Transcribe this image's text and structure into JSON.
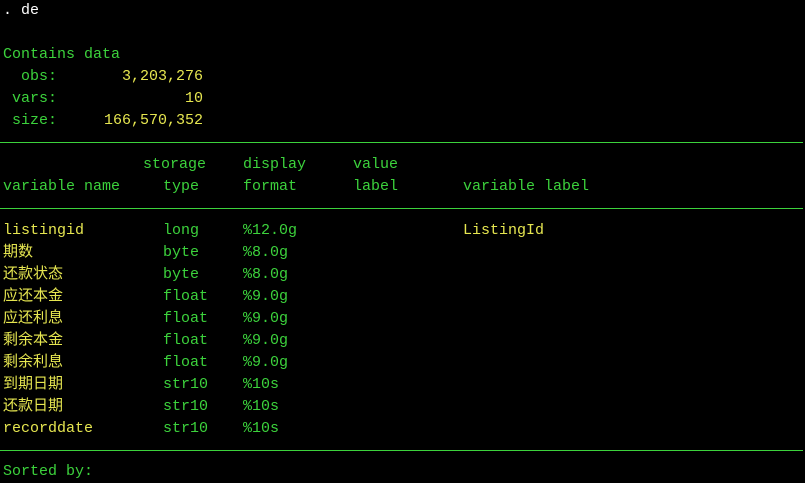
{
  "command": ". de",
  "summary": {
    "heading": "Contains data",
    "obs_label": "obs:",
    "obs_value": "3,203,276",
    "vars_label": "vars:",
    "vars_value": "10",
    "size_label": "size:",
    "size_value": "166,570,352"
  },
  "headers": {
    "storage_top": "storage",
    "storage_bottom": "type",
    "display_top": "display",
    "display_bottom": "format",
    "value_top": "value",
    "value_bottom": "label",
    "varname": "variable name",
    "varlabel": "variable label"
  },
  "variables": [
    {
      "name": "listingid",
      "type": "long",
      "format": "%12.0g",
      "value_label": "",
      "label": "ListingId"
    },
    {
      "name": "期数",
      "type": "byte",
      "format": "%8.0g",
      "value_label": "",
      "label": ""
    },
    {
      "name": "还款状态",
      "type": "byte",
      "format": "%8.0g",
      "value_label": "",
      "label": ""
    },
    {
      "name": "应还本金",
      "type": "float",
      "format": "%9.0g",
      "value_label": "",
      "label": ""
    },
    {
      "name": "应还利息",
      "type": "float",
      "format": "%9.0g",
      "value_label": "",
      "label": ""
    },
    {
      "name": "剩余本金",
      "type": "float",
      "format": "%9.0g",
      "value_label": "",
      "label": ""
    },
    {
      "name": "剩余利息",
      "type": "float",
      "format": "%9.0g",
      "value_label": "",
      "label": ""
    },
    {
      "name": "到期日期",
      "type": "str10",
      "format": "%10s",
      "value_label": "",
      "label": ""
    },
    {
      "name": "还款日期",
      "type": "str10",
      "format": "%10s",
      "value_label": "",
      "label": ""
    },
    {
      "name": "recorddate",
      "type": "str10",
      "format": "%10s",
      "value_label": "",
      "label": ""
    }
  ],
  "footer": {
    "sorted_by": "Sorted by:"
  },
  "colors": {
    "background": "#000000",
    "green": "#3cd23c",
    "yellow": "#e6e650",
    "white": "#ffffff"
  }
}
